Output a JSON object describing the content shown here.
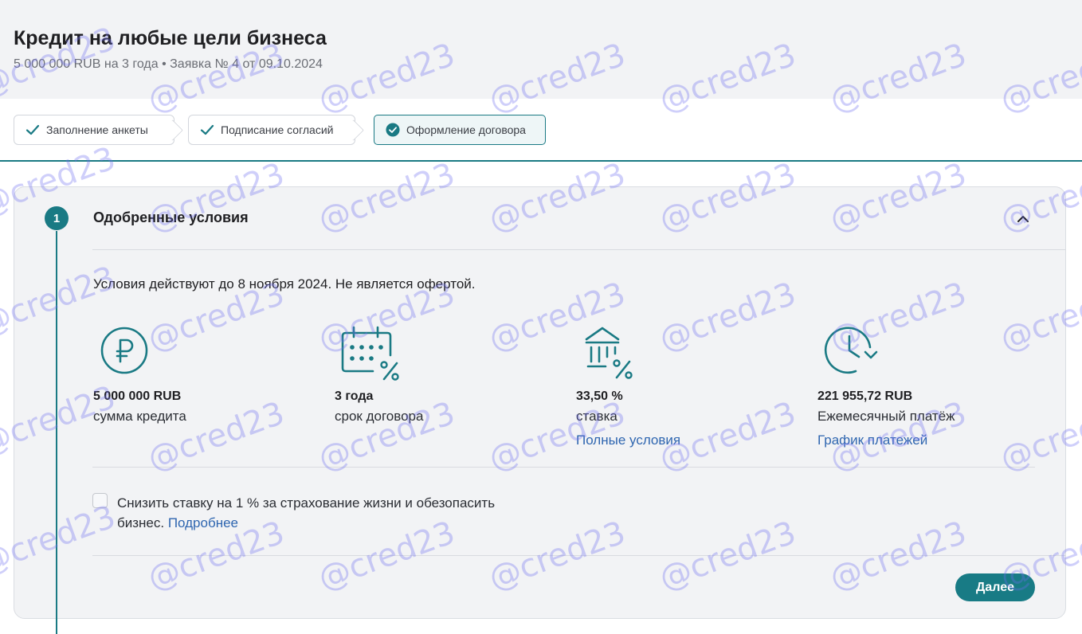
{
  "header": {
    "title": "Кредит на любые цели бизнеса",
    "subtitle": "5 000 000 RUB на 3 года • Заявка № 4 от 09.10.2024"
  },
  "steps": [
    {
      "label": "Заполнение анкеты",
      "icon": "check-icon",
      "state": "done"
    },
    {
      "label": "Подписание согласий",
      "icon": "check-icon",
      "state": "done"
    },
    {
      "label": "Оформление договора",
      "icon": "check-circle-icon",
      "state": "active"
    }
  ],
  "section": {
    "number": "1",
    "title": "Одобренные условия",
    "validity": "Условия действуют до 8 ноября 2024. Не является офертой."
  },
  "metrics": [
    {
      "icon": "ruble-icon",
      "value": "5 000 000 RUB",
      "label": "сумма кредита",
      "link": ""
    },
    {
      "icon": "calendar-percent-icon",
      "value": "3 года",
      "label": "срок договора",
      "link": ""
    },
    {
      "icon": "bank-percent-icon",
      "value": "33,50 %",
      "label": "ставка",
      "link": "Полные условия"
    },
    {
      "icon": "clock-refresh-icon",
      "value": "221 955,72 RUB",
      "label": "Ежемесячный платёж",
      "link": "График платежей"
    }
  ],
  "insurance": {
    "checked": false,
    "text": "Снизить ставку на 1 % за страхование жизни и обезопасить бизнес.",
    "link": "Подробнее"
  },
  "actions": {
    "next_label": "Далее"
  },
  "watermark": "@cred23",
  "colors": {
    "accent": "#1a7a84",
    "link": "#2f66b0",
    "watermark": "#6e6ef0"
  }
}
